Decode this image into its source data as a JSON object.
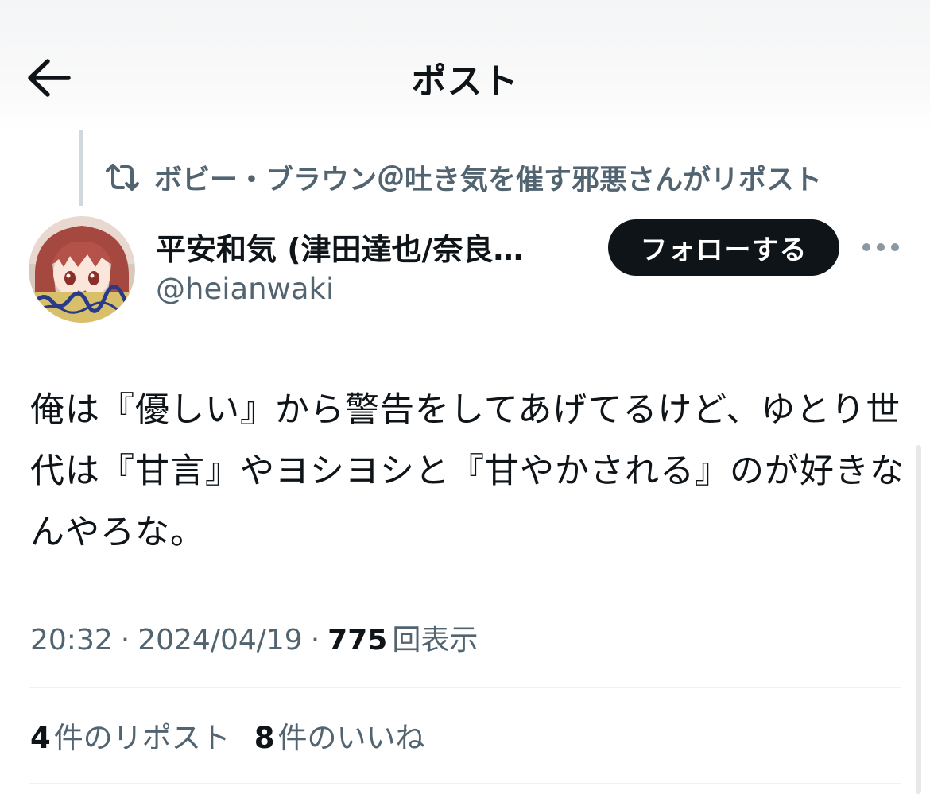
{
  "header": {
    "title": "ポスト",
    "back_icon": "arrow-left-icon"
  },
  "repost_context": {
    "icon": "repost-icon",
    "text": "ボビー・ブラウン＠吐き気を催す邪悪さんがリポスト"
  },
  "author": {
    "display_name": "平安和気 (津田達也/奈良…",
    "handle": "@heianwaki",
    "follow_label": "フォローする",
    "more_icon": "more-horizontal-icon"
  },
  "tweet": {
    "text": "俺は『優しい』から警告をしてあげてるけど、ゆとり世代は『甘言』やヨシヨシと『甘やかされる』のが好きなんやろな。"
  },
  "meta": {
    "time": "20:32",
    "separator": "·",
    "date": "2024/04/19",
    "views_count": "775",
    "views_label": "回表示"
  },
  "stats": {
    "reposts_count": "4",
    "reposts_label": "件のリポスト",
    "likes_count": "8",
    "likes_label": "件のいいね"
  },
  "colors": {
    "text_primary": "#0f1419",
    "text_secondary": "#536471",
    "divider": "#eff3f4",
    "follow_bg": "#0f1419"
  }
}
